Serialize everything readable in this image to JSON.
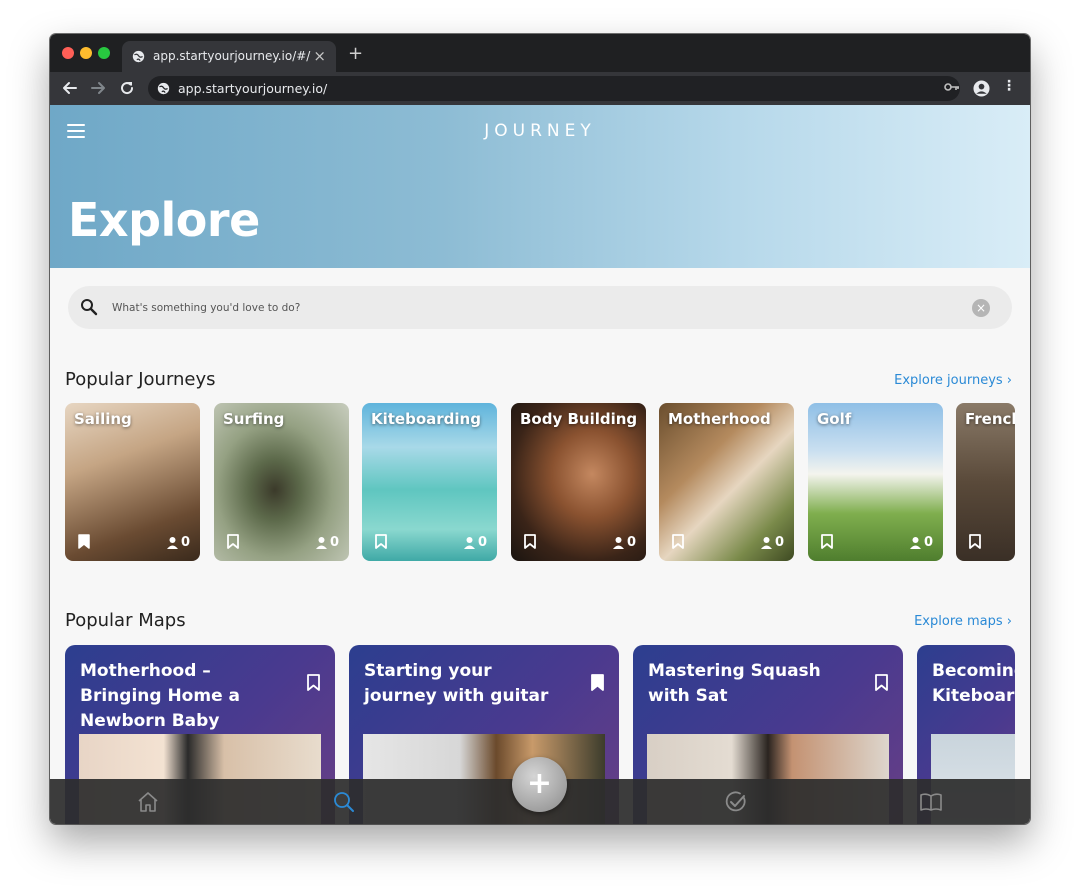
{
  "browser": {
    "tab_title": "app.startyourjourney.io/#/",
    "tab_close": "×",
    "new_tab": "+",
    "url": "app.startyourjourney.io/",
    "back_icon": "arrow-left-icon",
    "forward_icon": "arrow-right-icon",
    "reload_icon": "reload-icon",
    "key_icon": "key-icon",
    "account_icon": "account-icon",
    "menu_icon": "more-vert-icon"
  },
  "header": {
    "brand": "JOURNEY",
    "title": "Explore"
  },
  "search": {
    "placeholder": "What's something you'd love to do?",
    "clear": "×"
  },
  "journeys": {
    "title": "Popular Journeys",
    "link": "Explore journeys ›",
    "items": [
      {
        "name": "Sailing",
        "count": "0",
        "bookmarked": true
      },
      {
        "name": "Surfing",
        "count": "0",
        "bookmarked": false
      },
      {
        "name": "Kiteboarding",
        "count": "0",
        "bookmarked": false
      },
      {
        "name": "Body Building",
        "count": "0",
        "bookmarked": false
      },
      {
        "name": "Motherhood",
        "count": "0",
        "bookmarked": false
      },
      {
        "name": "Golf",
        "count": "0",
        "bookmarked": false
      },
      {
        "name": "French",
        "count": "",
        "bookmarked": false
      }
    ]
  },
  "maps": {
    "title": "Popular Maps",
    "link": "Explore maps ›",
    "items": [
      {
        "title": "Motherhood – Bringing Home a Newborn Baby",
        "bookmarked": false
      },
      {
        "title": "Starting your journey with guitar",
        "bookmarked": true
      },
      {
        "title": "Mastering Squash with Sat",
        "bookmarked": false
      },
      {
        "title": "Becoming a Kiteboarder",
        "bookmarked": false
      }
    ]
  },
  "bottom_nav": {
    "items": [
      "home-icon",
      "search-icon",
      "add-icon",
      "check-circle-icon",
      "book-icon"
    ],
    "active": "search-icon",
    "fab_label": "+"
  },
  "colors": {
    "accent": "#2b8ad6",
    "map_card": "#3a3c8f"
  }
}
